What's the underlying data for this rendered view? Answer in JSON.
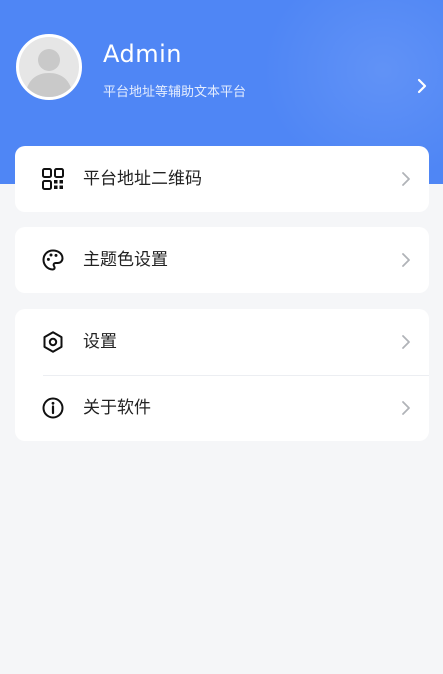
{
  "profile": {
    "name": "Admin",
    "subtitle": "平台地址等辅助文本平台"
  },
  "menu": {
    "qrcode": {
      "label": "平台地址二维码",
      "icon": "qrcode-icon"
    },
    "theme": {
      "label": "主题色设置",
      "icon": "palette-icon"
    },
    "settings": {
      "label": "设置",
      "icon": "hexagon-settings-icon"
    },
    "about": {
      "label": "关于软件",
      "icon": "info-icon"
    }
  },
  "colors": {
    "header": "#4f86f5",
    "background": "#f5f6f8",
    "card": "#ffffff",
    "text": "#222222",
    "chevron": "#b0b3b8"
  }
}
